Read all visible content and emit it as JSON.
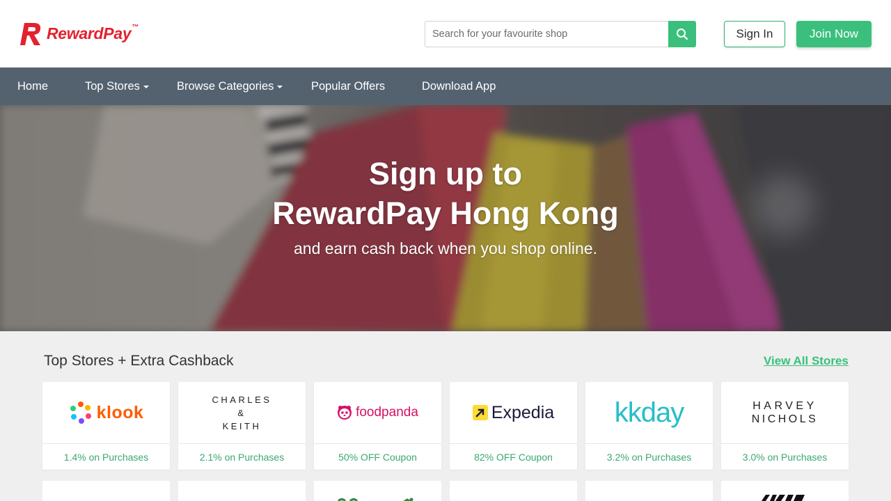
{
  "brand": {
    "name": "RewardPay",
    "tm": "™",
    "color": "#e3212f",
    "accent": "#3ac07c"
  },
  "search": {
    "placeholder": "Search for your favourite shop",
    "icon": "search-icon"
  },
  "auth": {
    "signin_label": "Sign In",
    "join_label": "Join Now"
  },
  "nav": {
    "items": [
      {
        "label": "Home",
        "dropdown": false
      },
      {
        "label": "Top Stores",
        "dropdown": true
      },
      {
        "label": "Browse Categories",
        "dropdown": true
      },
      {
        "label": "Popular Offers",
        "dropdown": false
      },
      {
        "label": "Download App",
        "dropdown": false
      }
    ]
  },
  "hero": {
    "title_line1": "Sign up to",
    "title_line2": "RewardPay Hong Kong",
    "subtitle": "and earn cash back when you shop online."
  },
  "top_stores": {
    "title": "Top Stores + Extra Cashback",
    "view_all": "View All Stores",
    "stores": [
      {
        "name": "klook",
        "offer": "1.4% on Purchases"
      },
      {
        "name": "CHARLES & KEITH",
        "line1": "CHARLES",
        "line2": "&",
        "line3": "KEITH",
        "offer": "2.1% on Purchases"
      },
      {
        "name": "foodpanda",
        "offer": "50% OFF Coupon"
      },
      {
        "name": "Expedia",
        "offer": "82% OFF Coupon"
      },
      {
        "name": "kkday",
        "offer": "3.2% on Purchases"
      },
      {
        "name": "HARVEY NICHOLS",
        "line1": "HARVEY",
        "line2": "NICHOLS",
        "offer": "3.0% on Purchases"
      }
    ]
  }
}
